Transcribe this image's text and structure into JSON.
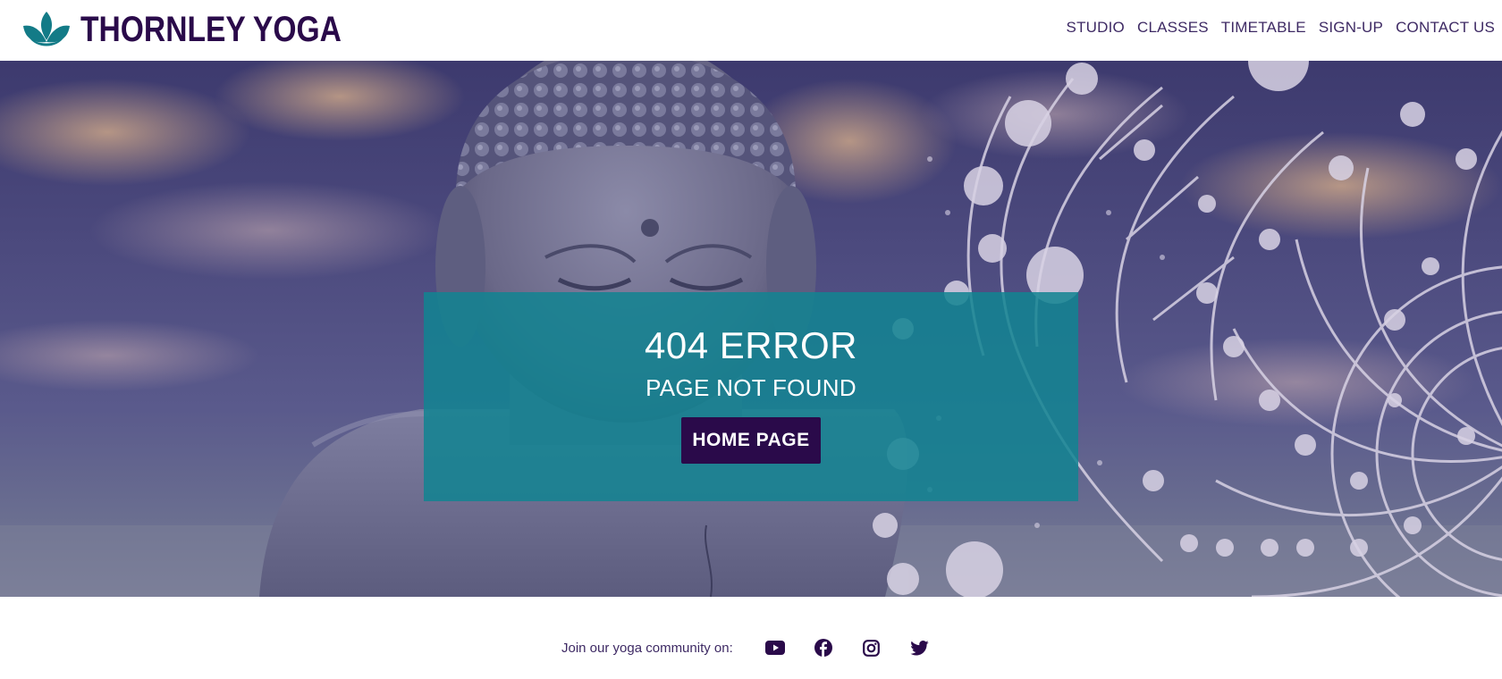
{
  "brand": {
    "name": "THORNLEY YOGA",
    "logo_icon": "lotus-icon",
    "logo_color": "#137b87"
  },
  "nav": {
    "items": [
      {
        "label": "STUDIO"
      },
      {
        "label": "CLASSES"
      },
      {
        "label": "TIMETABLE"
      },
      {
        "label": "SIGN-UP"
      },
      {
        "label": "CONTACT US"
      }
    ]
  },
  "hero": {
    "background": "buddha-statue-with-mandala-photo",
    "error_title": "404 ERROR",
    "error_subtitle": "PAGE NOT FOUND",
    "home_button_label": "HOME PAGE"
  },
  "footer": {
    "join_text": "Join our yoga community on:",
    "social": [
      {
        "icon": "youtube-icon"
      },
      {
        "icon": "facebook-icon"
      },
      {
        "icon": "instagram-icon"
      },
      {
        "icon": "twitter-icon"
      }
    ]
  },
  "colors": {
    "brand_purple": "#2a0a4a",
    "teal": "#137b87",
    "overlay_teal": "#128491",
    "nav_text": "#3e2a64"
  }
}
